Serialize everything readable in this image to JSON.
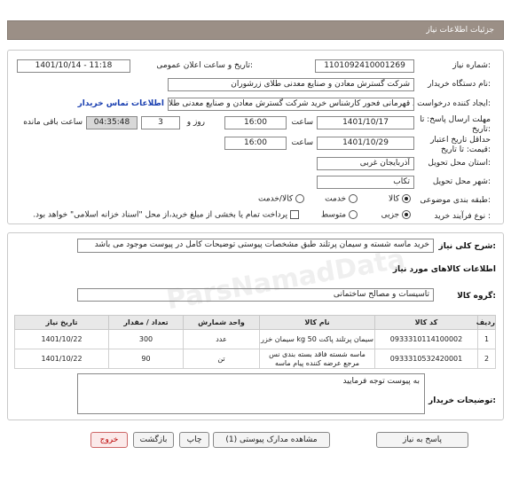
{
  "header": {
    "title": "جزئیات اطلاعات نیاز"
  },
  "info": {
    "need_number_label": "شماره نیاز:",
    "need_number": "1101092410001269",
    "announce_label": "تاریخ و ساعت اعلان عمومی:",
    "announce_value": "1401/10/14 - 11:18",
    "buyer_org_label": "نام دستگاه خریدار:",
    "buyer_org": "شرکت گسترش معادن و صنایع معدنی طلای زرشوران",
    "creator_label": "ایجاد کننده درخواست:",
    "creator": "صمد قهرمانی فحور کارشناس خرید شرکت گسترش معادن و صنایع معدنی طلا",
    "contact_link": "اطلاعات تماس خریدار",
    "deadline_label": "مهلت ارسال پاسخ: تا تاریخ:",
    "deadline_date": "1401/10/17",
    "time_label": "ساعت",
    "deadline_time": "16:00",
    "days_value": "3",
    "days_label": "روز و",
    "remaining_time": "04:35:48",
    "remaining_label": "ساعت باقی مانده",
    "validity_label": "حداقل تاریخ اعتبار قیمت: تا تاریخ:",
    "validity_date": "1401/10/29",
    "validity_time": "16:00",
    "province_label": "استان محل تحویل:",
    "province": "آذربایجان غربی",
    "city_label": "شهر محل تحویل:",
    "city": "تکاب",
    "category_label": "طبقه بندی موضوعی:",
    "category_options": [
      "کالا",
      "خدمت",
      "کالا/خدمت"
    ],
    "process_label": "نوع فرآیند خرید :",
    "process_options": [
      "جزیی",
      "متوسط"
    ],
    "payment_note": "پرداخت تمام یا بخشی از مبلغ خرید،از محل \"اسناد خزانه اسلامی\" خواهد بود."
  },
  "description": {
    "label": "شرح کلی نیاز:",
    "text": "خرید ماسه شسته و سیمان پرتلند طبق مشخصات پیوستی توضیحات کامل در پیوست موجود می باشد"
  },
  "goods": {
    "section_title": "اطلاعات کالاهای مورد نیاز",
    "group_label": "گروه کالا:",
    "group_value": "تاسیسات و مصالح ساختمانی",
    "columns": [
      "ردیف",
      "کد کالا",
      "نام کالا",
      "واحد شمارش",
      "تعداد / مقدار",
      "تاریخ نیاز"
    ],
    "rows": [
      {
        "row": "1",
        "code": "0933310114100002",
        "name": "سیمان پرتلند پاکت 50 kg سیمان خزر",
        "unit": "عدد",
        "qty": "300",
        "date": "1401/10/22"
      },
      {
        "row": "2",
        "code": "0933310532420001",
        "name": "ماسه شسته فاقد بسته بندی نس مرجع عرضه کننده پیام ماسه",
        "unit": "تن",
        "qty": "90",
        "date": "1401/10/22"
      }
    ]
  },
  "buyer_notes": {
    "label": "توضیحات خریدار:",
    "text": "به پیوست توجه فرمایید"
  },
  "buttons": {
    "reply": "پاسخ به نیاز",
    "view_docs": "مشاهده مدارک پیوستی (1)",
    "print": "چاپ",
    "back": "بازگشت",
    "exit": "خروج"
  },
  "watermark": {
    "text": "ParsNamadData"
  }
}
